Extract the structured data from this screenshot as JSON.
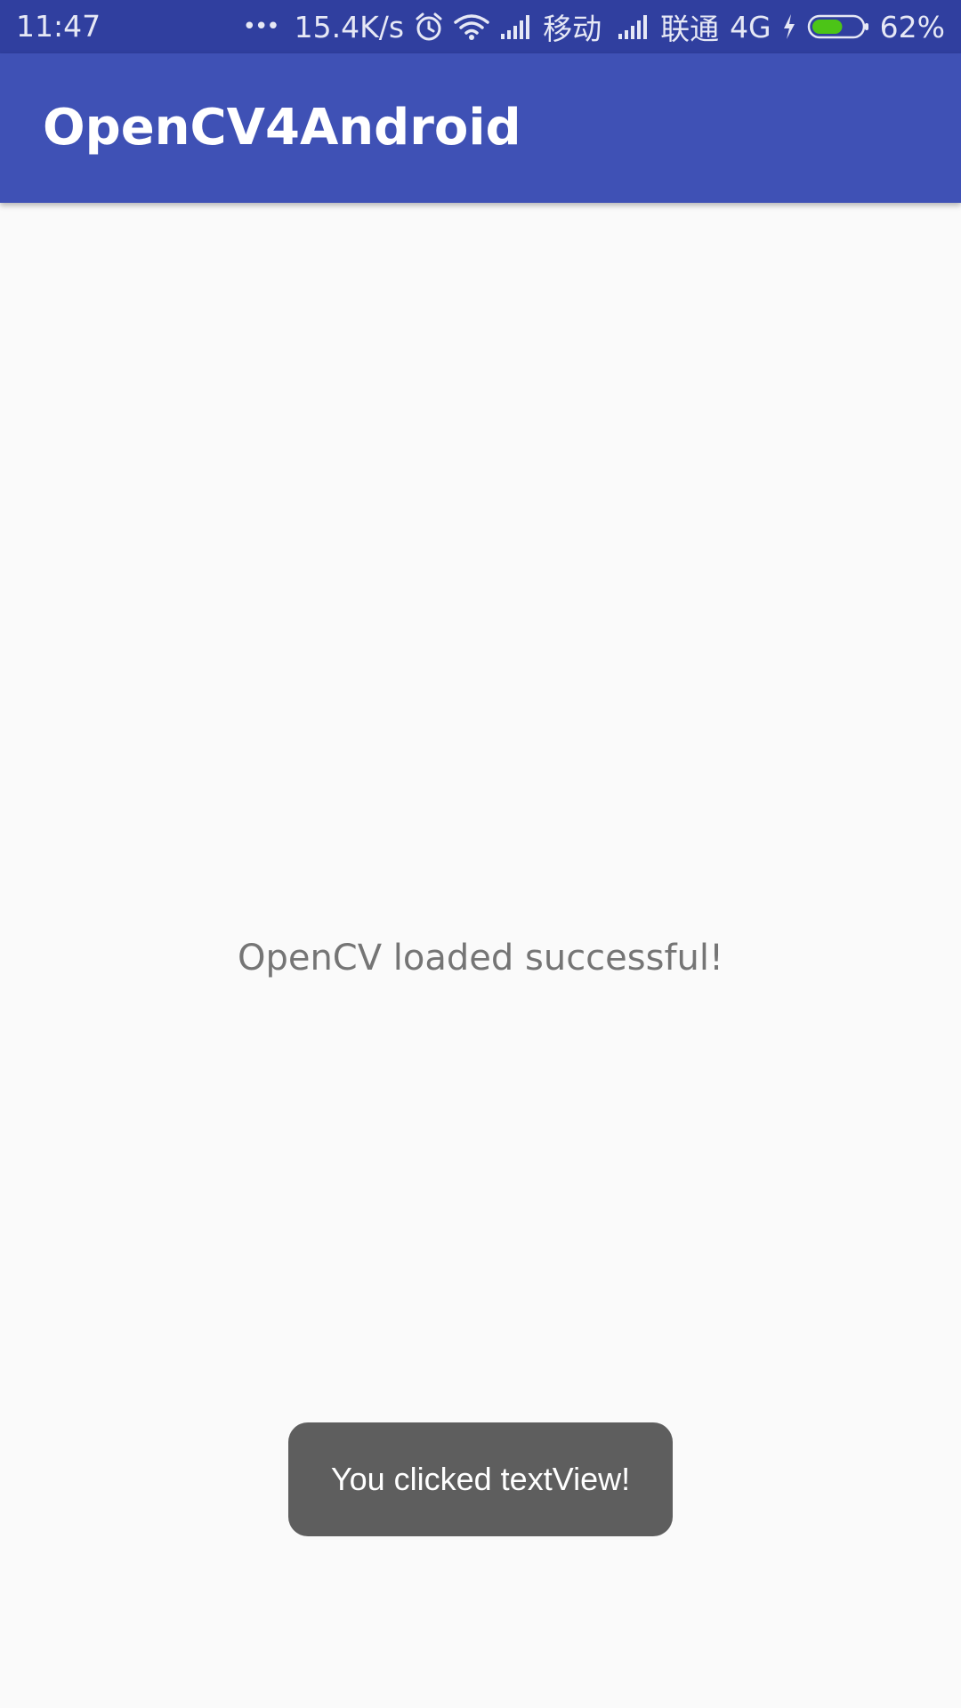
{
  "status_bar": {
    "time": "11:47",
    "overflow_dots": "•••",
    "network_speed": "15.4K/s",
    "carrier_1": "移动",
    "carrier_2": "联通",
    "network_type": "4G",
    "battery_percent": "62%",
    "battery_level": 0.62,
    "icons": [
      "more-dots-icon",
      "alarm-clock-icon",
      "wifi-icon",
      "signal-icon",
      "charging-bolt-icon",
      "battery-icon"
    ],
    "battery_fill_color": "#4CC417"
  },
  "app_bar": {
    "title": "OpenCV4Android",
    "color": "#3F51B5"
  },
  "main": {
    "text_view": "OpenCV loaded successful!"
  },
  "toast": {
    "message": "You clicked textView!"
  }
}
